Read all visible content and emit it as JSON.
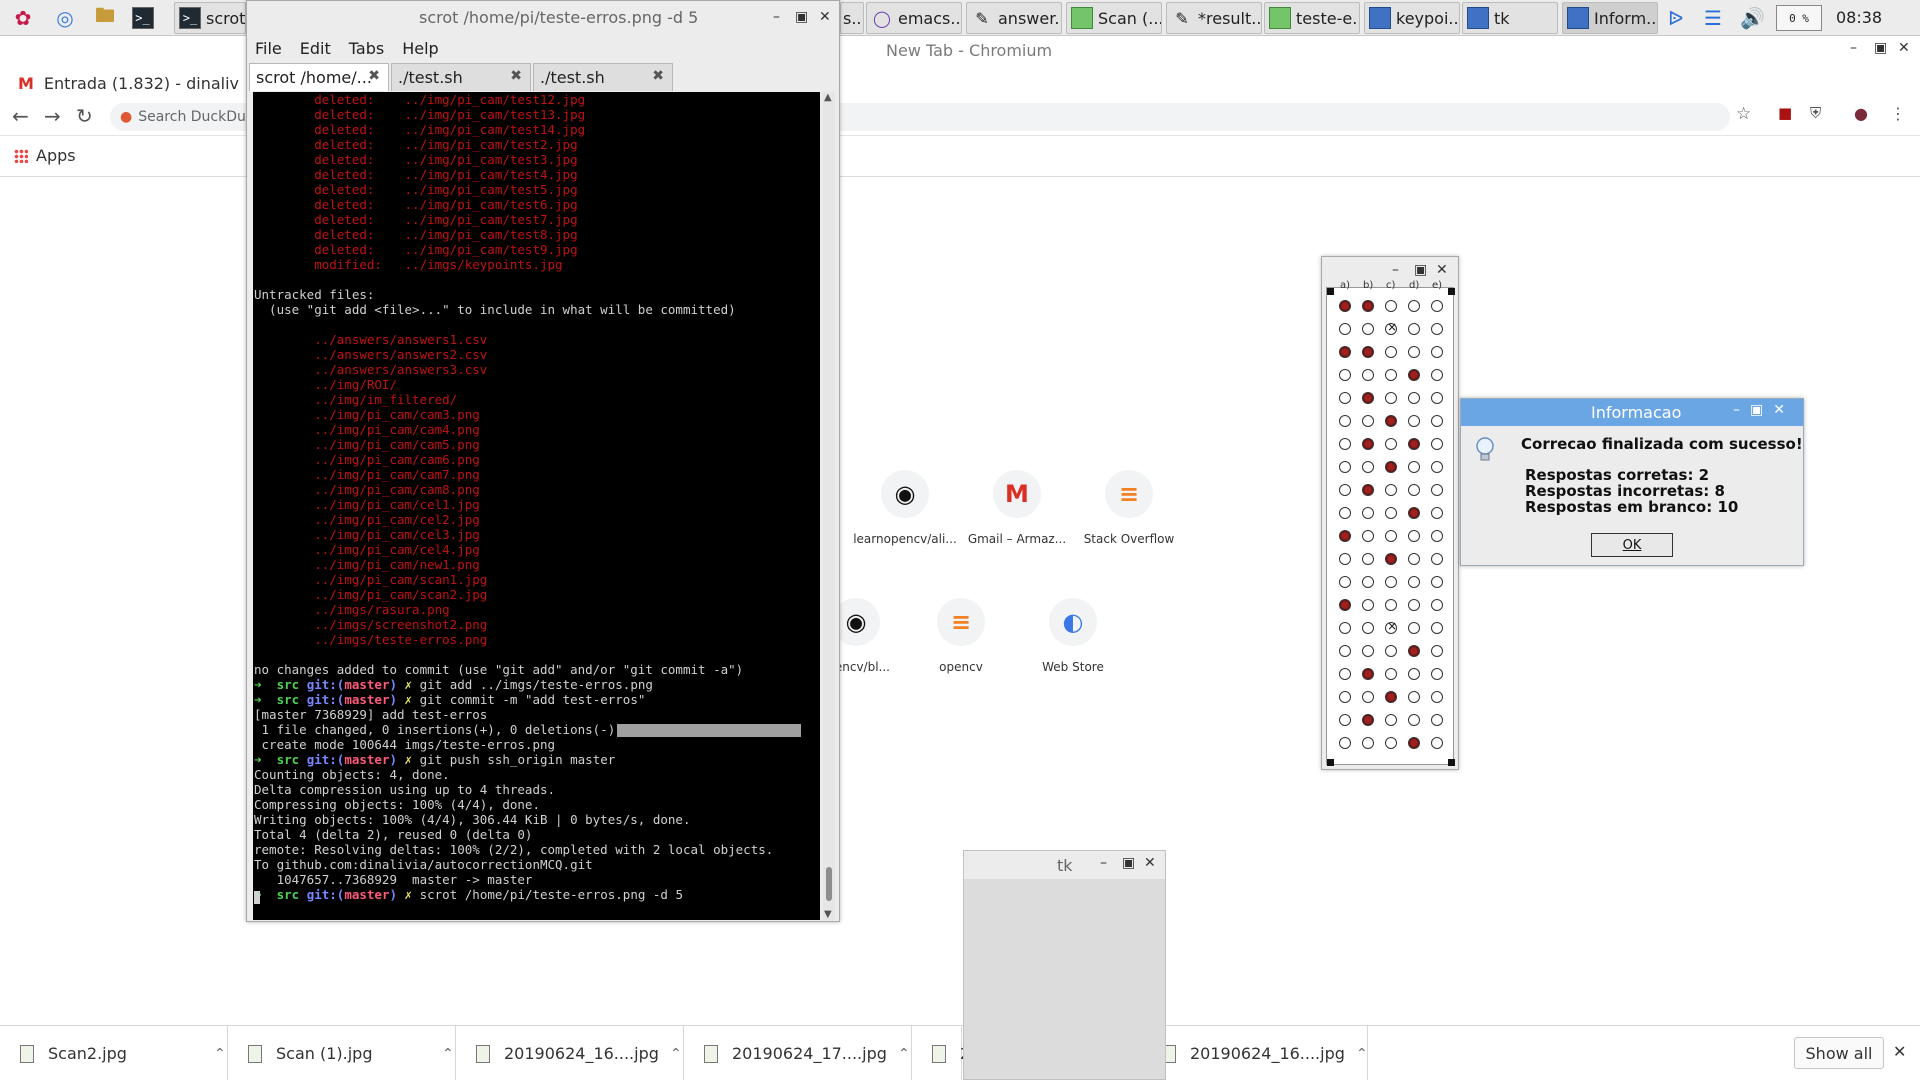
{
  "taskbar": {
    "launchers": [
      "raspberry-menu-icon",
      "web-browser-icon",
      "file-manager-icon",
      "terminal-icon"
    ],
    "tasks": [
      {
        "label": "scrot",
        "icon": "terminal-icon"
      },
      {
        "label": "s...",
        "icon": "window-icon"
      },
      {
        "label": "emacs...",
        "icon": "emacs-icon"
      },
      {
        "label": "answer...",
        "icon": "text-editor-icon"
      },
      {
        "label": "Scan (...",
        "icon": "image-viewer-icon"
      },
      {
        "label": "*result...",
        "icon": "text-editor-icon"
      },
      {
        "label": "teste-e...",
        "icon": "image-viewer-icon"
      },
      {
        "label": "keypoi...",
        "icon": "window-icon"
      },
      {
        "label": "tk",
        "icon": "window-icon"
      },
      {
        "label": "Inform...",
        "icon": "window-icon"
      }
    ],
    "cpu": "0 %",
    "clock": "08:38"
  },
  "chromium": {
    "title": "New Tab - Chromium",
    "tab_label": "Entrada (1.832) - dinaliv",
    "omnibox_placeholder": "Search DuckDuc",
    "bookmark_apps": "Apps",
    "shortcuts_row1": [
      {
        "label": "learnopencv/ali...",
        "icon": "github-icon"
      },
      {
        "label": "Gmail – Armaz...",
        "icon": "gmail-icon"
      },
      {
        "label": "Stack Overflow",
        "icon": "stackoverflow-icon"
      }
    ],
    "shortcuts_row2": [
      {
        "label": "opencv/bl...",
        "icon": "github-icon"
      },
      {
        "label": "opencv",
        "icon": "stackoverflow-icon"
      },
      {
        "label": "Web Store",
        "icon": "webstore-icon"
      }
    ]
  },
  "downloads": {
    "items": [
      {
        "name": "Scan2.jpg"
      },
      {
        "name": "Scan (1).jpg"
      },
      {
        "name": "20190624_16....jpg"
      },
      {
        "name": "20190624_17....jpg"
      },
      {
        "name": "2"
      },
      {
        "name": "20190624_16....jpg"
      }
    ],
    "show_all": "Show all"
  },
  "terminal": {
    "title": "scrot /home/pi/teste-erros.png -d 5",
    "menu": [
      "File",
      "Edit",
      "Tabs",
      "Help"
    ],
    "tabs": [
      "scrot /home/...",
      "./test.sh",
      "./test.sh"
    ],
    "lines": [
      {
        "t": "        deleted:    ../img/pi_cam/test12.jpg",
        "c": "red"
      },
      {
        "t": "        deleted:    ../img/pi_cam/test13.jpg",
        "c": "red"
      },
      {
        "t": "        deleted:    ../img/pi_cam/test14.jpg",
        "c": "red"
      },
      {
        "t": "        deleted:    ../img/pi_cam/test2.jpg",
        "c": "red"
      },
      {
        "t": "        deleted:    ../img/pi_cam/test3.jpg",
        "c": "red"
      },
      {
        "t": "        deleted:    ../img/pi_cam/test4.jpg",
        "c": "red"
      },
      {
        "t": "        deleted:    ../img/pi_cam/test5.jpg",
        "c": "red"
      },
      {
        "t": "        deleted:    ../img/pi_cam/test6.jpg",
        "c": "red"
      },
      {
        "t": "        deleted:    ../img/pi_cam/test7.jpg",
        "c": "red"
      },
      {
        "t": "        deleted:    ../img/pi_cam/test8.jpg",
        "c": "red"
      },
      {
        "t": "        deleted:    ../img/pi_cam/test9.jpg",
        "c": "red"
      },
      {
        "t": "        modified:   ../imgs/keypoints.jpg",
        "c": "red"
      },
      {
        "t": "",
        "c": "wht"
      },
      {
        "t": "Untracked files:",
        "c": "wht"
      },
      {
        "t": "  (use \"git add <file>...\" to include in what will be committed)",
        "c": "wht"
      },
      {
        "t": "",
        "c": "wht"
      },
      {
        "t": "        ../answers/answers1.csv",
        "c": "red"
      },
      {
        "t": "        ../answers/answers2.csv",
        "c": "red"
      },
      {
        "t": "        ../answers/answers3.csv",
        "c": "red"
      },
      {
        "t": "        ../img/ROI/",
        "c": "red"
      },
      {
        "t": "        ../img/im_filtered/",
        "c": "red"
      },
      {
        "t": "        ../img/pi_cam/cam3.png",
        "c": "red"
      },
      {
        "t": "        ../img/pi_cam/cam4.png",
        "c": "red"
      },
      {
        "t": "        ../img/pi_cam/cam5.png",
        "c": "red"
      },
      {
        "t": "        ../img/pi_cam/cam6.png",
        "c": "red"
      },
      {
        "t": "        ../img/pi_cam/cam7.png",
        "c": "red"
      },
      {
        "t": "        ../img/pi_cam/cam8.png",
        "c": "red"
      },
      {
        "t": "        ../img/pi_cam/cel1.jpg",
        "c": "red"
      },
      {
        "t": "        ../img/pi_cam/cel2.jpg",
        "c": "red"
      },
      {
        "t": "        ../img/pi_cam/cel3.jpg",
        "c": "red"
      },
      {
        "t": "        ../img/pi_cam/cel4.jpg",
        "c": "red"
      },
      {
        "t": "        ../img/pi_cam/new1.png",
        "c": "red"
      },
      {
        "t": "        ../img/pi_cam/scan1.jpg",
        "c": "red"
      },
      {
        "t": "        ../img/pi_cam/scan2.jpg",
        "c": "red"
      },
      {
        "t": "        ../imgs/rasura.png",
        "c": "red"
      },
      {
        "t": "        ../imgs/screenshot2.png",
        "c": "red"
      },
      {
        "t": "        ../imgs/teste-erros.png",
        "c": "red"
      },
      {
        "t": "",
        "c": "wht"
      },
      {
        "t": "no changes added to commit (use \"git add\" and/or \"git commit -a\")",
        "c": "wht"
      },
      {
        "prompt": true,
        "cmd": "git add ../imgs/teste-erros.png"
      },
      {
        "prompt": true,
        "cmd": "git commit -m \"add test-erros\""
      },
      {
        "t": "[master 7368929] add test-erros",
        "c": "wht"
      },
      {
        "t": " 1 file changed, 0 insertions(+), 0 deletions(-)",
        "c": "wht",
        "hl": true
      },
      {
        "t": " create mode 100644 imgs/teste-erros.png",
        "c": "wht"
      },
      {
        "prompt": true,
        "cmd": "git push ssh_origin master"
      },
      {
        "t": "Counting objects: 4, done.",
        "c": "wht"
      },
      {
        "t": "Delta compression using up to 4 threads.",
        "c": "wht"
      },
      {
        "t": "Compressing objects: 100% (4/4), done.",
        "c": "wht"
      },
      {
        "t": "Writing objects: 100% (4/4), 306.44 KiB | 0 bytes/s, done.",
        "c": "wht"
      },
      {
        "t": "Total 4 (delta 2), reused 0 (delta 0)",
        "c": "wht"
      },
      {
        "t": "remote: Resolving deltas: 100% (2/2), completed with 2 local objects.",
        "c": "wht"
      },
      {
        "t": "To github.com:dinalivia/autocorrectionMCQ.git",
        "c": "wht"
      },
      {
        "t": "   1047657..7368929  master -> master",
        "c": "wht"
      },
      {
        "prompt": true,
        "cmd": "scrot /home/pi/teste-erros.png -d 5"
      }
    ],
    "prompt": {
      "arrow": "➜",
      "dir": "src",
      "git": "git:(",
      "branch": "master",
      "close": ")",
      "mark": "✗"
    }
  },
  "answer_sheet": {
    "columns": [
      "a)",
      "b)",
      "c)",
      "d)",
      "e)"
    ],
    "marks": [
      [
        "f",
        "f",
        "o",
        "o",
        "o"
      ],
      [
        "o",
        "o",
        "x",
        "o",
        "o"
      ],
      [
        "f",
        "f",
        "o",
        "o",
        "o"
      ],
      [
        "o",
        "o",
        "o",
        "f",
        "o"
      ],
      [
        "o",
        "f",
        "o",
        "o",
        "o"
      ],
      [
        "o",
        "o",
        "f",
        "o",
        "o"
      ],
      [
        "o",
        "f",
        "o",
        "f",
        "o"
      ],
      [
        "o",
        "o",
        "f",
        "o",
        "o"
      ],
      [
        "o",
        "f",
        "o",
        "o",
        "o"
      ],
      [
        "o",
        "o",
        "o",
        "f",
        "o"
      ],
      [
        "f",
        "o",
        "o",
        "o",
        "o"
      ],
      [
        "o",
        "o",
        "f",
        "o",
        "o"
      ],
      [
        "o",
        "o",
        "o",
        "o",
        "o"
      ],
      [
        "f",
        "o",
        "o",
        "o",
        "o"
      ],
      [
        "o",
        "o",
        "x",
        "o",
        "o"
      ],
      [
        "o",
        "o",
        "o",
        "f",
        "o"
      ],
      [
        "o",
        "f",
        "o",
        "o",
        "o"
      ],
      [
        "o",
        "o",
        "f",
        "o",
        "o"
      ],
      [
        "o",
        "f",
        "o",
        "o",
        "o"
      ],
      [
        "o",
        "o",
        "o",
        "f",
        "o"
      ]
    ]
  },
  "dialog": {
    "title": "Informacao",
    "message": "Correcao finalizada com sucesso!",
    "stats": [
      "Respostas corretas: 2",
      "Respostas incorretas: 8",
      "Respostas em branco: 10"
    ],
    "ok": "OK"
  },
  "tk_window": {
    "title": "tk"
  }
}
